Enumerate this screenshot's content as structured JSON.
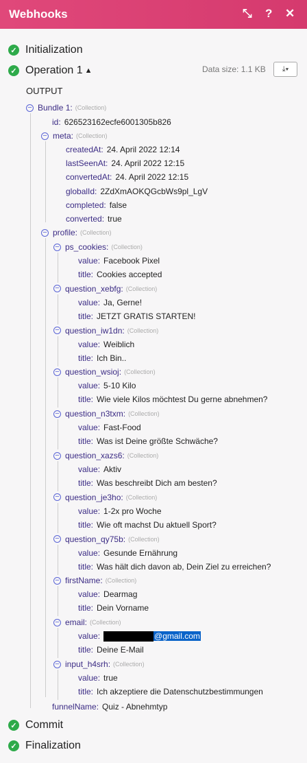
{
  "window": {
    "title": "Webhooks",
    "icons": [
      "expand-icon",
      "help-icon",
      "close-icon"
    ]
  },
  "steps": {
    "initialization": "Initialization",
    "operation": "Operation 1",
    "commit": "Commit",
    "finalization": "Finalization"
  },
  "data_size": "Data size: 1.1 KB",
  "output_label": "OUTPUT",
  "type_label": "(Collection)",
  "bundle": {
    "label": "Bundle 1:",
    "id_key": "id:",
    "id": "626523162ecfe6001305b826"
  },
  "meta": {
    "key": "meta:",
    "fields": [
      {
        "key": "createdAt:",
        "value": "24. April 2022 12:14"
      },
      {
        "key": "lastSeenAt:",
        "value": "24. April 2022 12:15"
      },
      {
        "key": "convertedAt:",
        "value": "24. April 2022 12:15"
      },
      {
        "key": "globalId:",
        "value": "2ZdXmAOKQGcbWs9pl_LgV"
      },
      {
        "key": "completed:",
        "value": "false"
      },
      {
        "key": "converted:",
        "value": "true"
      }
    ]
  },
  "profile": {
    "key": "profile:",
    "collections": [
      {
        "key": "ps_cookies:",
        "value": "Facebook Pixel",
        "title": "Cookies accepted"
      },
      {
        "key": "question_xebfg:",
        "value": "Ja, Gerne!",
        "title": "JETZT GRATIS STARTEN!"
      },
      {
        "key": "question_iw1dn:",
        "value": "Weiblich",
        "title": "Ich Bin.."
      },
      {
        "key": "question_wsioj:",
        "value": "5-10 Kilo",
        "title": "Wie viele Kilos möchtest Du gerne abnehmen?"
      },
      {
        "key": "question_n3txm:",
        "value": "Fast-Food",
        "title": "Was ist Deine größte Schwäche?"
      },
      {
        "key": "question_xazs6:",
        "value": "Aktiv",
        "title": "Was beschreibt Dich am besten?"
      },
      {
        "key": "question_je3ho:",
        "value": "1-2x pro Woche",
        "title": "Wie oft machst Du aktuell Sport?"
      },
      {
        "key": "question_qy75b:",
        "value": "Gesunde Ernährung",
        "title": "Was hält dich davon ab, Dein Ziel zu erreichen?"
      },
      {
        "key": "firstName:",
        "value": "Dearmag",
        "title": "Dein Vorname"
      },
      {
        "key": "email:",
        "value": "@gmail.com",
        "title": "Deine E-Mail"
      },
      {
        "key": "input_h4srh:",
        "value": "true",
        "title": "Ich akzeptiere die Datenschutzbestimmungen"
      }
    ]
  },
  "subkeys": {
    "value": "value:",
    "title": "title:"
  },
  "funnel": {
    "key": "funnelName:",
    "value": "Quiz - Abnehmtyp"
  }
}
